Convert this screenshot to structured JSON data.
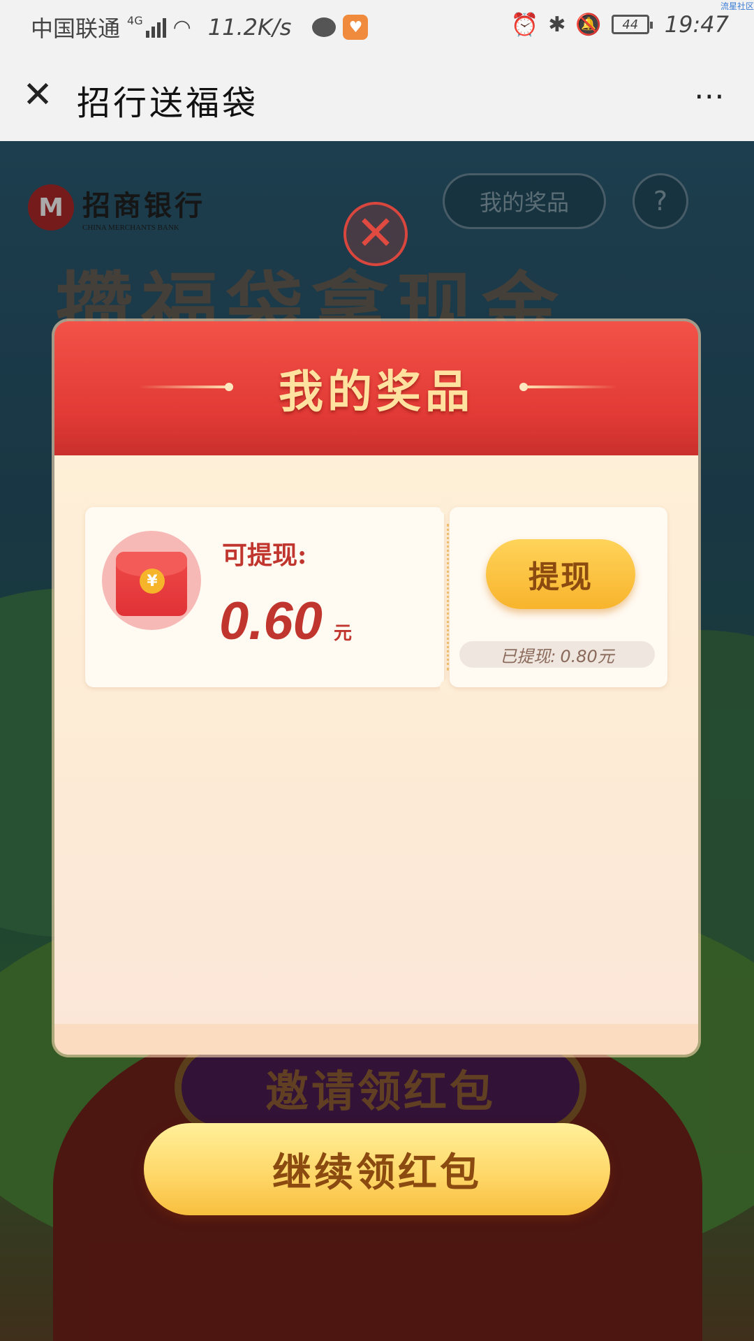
{
  "status_bar": {
    "carrier": "中国联通",
    "network": "4G",
    "speed": "11.2K/s",
    "battery": "44",
    "time": "19:47",
    "corner_tag": "流星社区"
  },
  "titlebar": {
    "close_glyph": "✕",
    "title": "招行送福袋",
    "more_glyph": "⋯"
  },
  "background": {
    "bank_name": "招商银行",
    "bank_name_en": "CHINA MERCHANTS BANK",
    "my_prizes": "我的奖品",
    "help": "?",
    "headline": "攒福袋拿现金",
    "invite": "邀请领红包"
  },
  "modal": {
    "close_glyph": "✕",
    "title": "我的奖品",
    "prize": {
      "available_label": "可提现:",
      "available_amount": "0.60",
      "unit": "元",
      "withdraw_button": "提现",
      "withdrawn_label": "已提现:",
      "withdrawn_amount": "0.80元",
      "coin_symbol": "¥"
    }
  },
  "continue_button": "继续领红包",
  "colors": {
    "header_red": "#e23a36",
    "title_gold": "#ffe2a0",
    "amount_red": "#c0362e",
    "button_gold": "#f8b42c",
    "button_text": "#8a4a10"
  }
}
